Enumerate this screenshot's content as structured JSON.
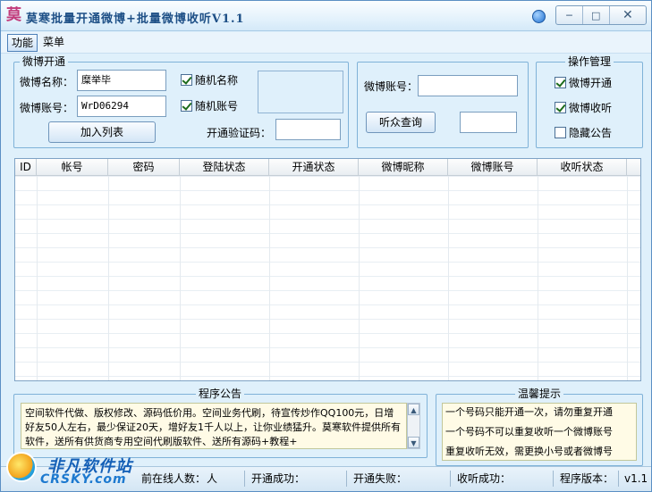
{
  "window": {
    "title": "莫寒批量开通微博+批量微博收听V1.1",
    "app_icon_glyph": "莫"
  },
  "menu": {
    "items": [
      "功能",
      "菜单"
    ]
  },
  "open_group": {
    "legend": "微博开通",
    "name_label": "微博名称：",
    "name_value": "糜举毕",
    "account_label": "微博账号：",
    "account_value": "WrD06294",
    "random_name_label": "随机名称",
    "random_name_checked": true,
    "random_account_label": "随机账号",
    "random_account_checked": true,
    "code_label": "开通验证码：",
    "code_value": "",
    "add_button": "加入列表"
  },
  "query_group": {
    "account_label": "微博账号：",
    "account_value": "",
    "query_button": "听众查询",
    "result_value": ""
  },
  "ops_group": {
    "legend": "操作管理",
    "items": [
      {
        "label": "微博开通",
        "checked": true
      },
      {
        "label": "微博收听",
        "checked": true
      },
      {
        "label": "隐藏公告",
        "checked": false
      }
    ]
  },
  "table": {
    "columns": [
      "ID",
      "帐号",
      "密码",
      "登陆状态",
      "开通状态",
      "微博昵称",
      "微博账号",
      "收听状态"
    ],
    "rows": []
  },
  "notice": {
    "legend": "程序公告",
    "text": "空间软件代做、版权修改、源码低价用。空间业务代刷，待宣传炒作QQ100元，日增好友50人左右，最少保证20天，增好友1千人以上，让你业绩猛升。莫寒软件提供所有软件，送所有供货商专用空间代刷版软件、送所有源码+教程+"
  },
  "tips": {
    "legend": "温馨提示",
    "lines": [
      "一个号码只能开通一次，请勿重复开通",
      "一个号码不可以重复收听一个微博账号",
      "重复收听无效，需更换小号或者微博号"
    ]
  },
  "status": {
    "online_label": "前在线人数：",
    "online_unit": "人",
    "success_label": "开通成功：",
    "fail_label": "开通失败：",
    "listen_success_label": "收听成功：",
    "version_label": "程序版本：",
    "version_value": "v1.1"
  },
  "watermark": {
    "cn": "非凡软件站",
    "en": "CRSKY.com"
  },
  "colors": {
    "accent": "#1d4f86",
    "panel_bg": "#dff0fb",
    "border": "#7fb2d8"
  }
}
